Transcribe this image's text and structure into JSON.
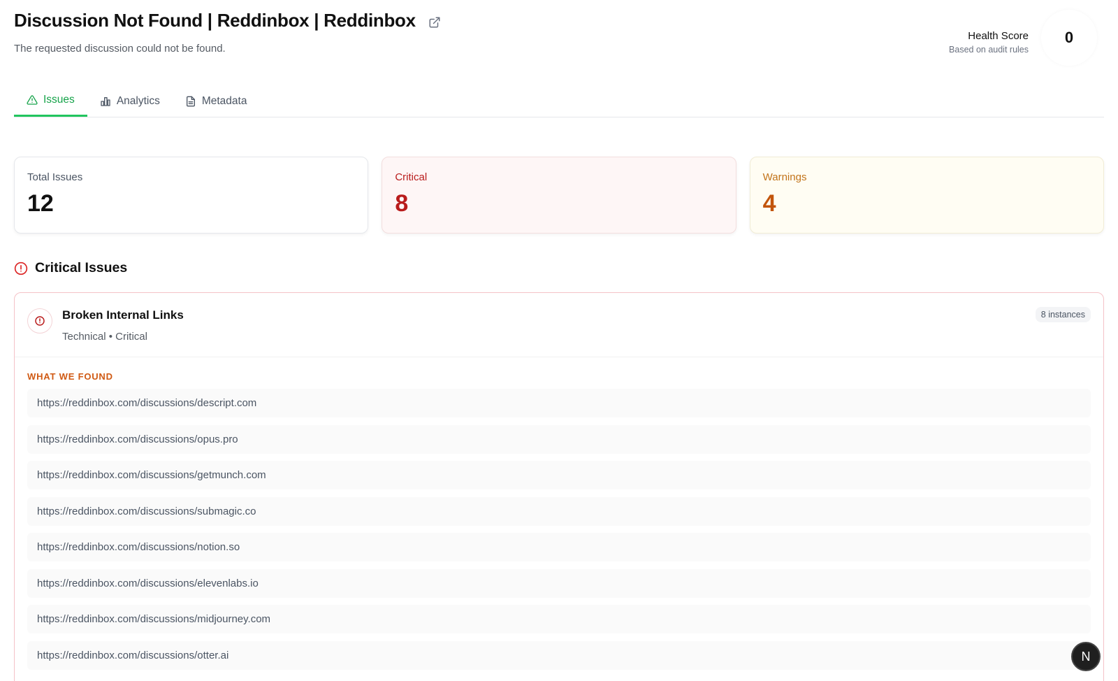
{
  "header": {
    "title": "Discussion Not Found | Reddinbox | Reddinbox",
    "subtitle": "The requested discussion could not be found.",
    "external_icon": "external-link-icon"
  },
  "health": {
    "title": "Health Score",
    "subtitle": "Based on audit rules",
    "score": "0"
  },
  "tabs": [
    {
      "label": "Issues",
      "icon": "alert-triangle-icon",
      "active": true
    },
    {
      "label": "Analytics",
      "icon": "bar-chart-icon",
      "active": false
    },
    {
      "label": "Metadata",
      "icon": "document-icon",
      "active": false
    }
  ],
  "stats": {
    "total": {
      "label": "Total Issues",
      "value": "12"
    },
    "critical": {
      "label": "Critical",
      "value": "8"
    },
    "warnings": {
      "label": "Warnings",
      "value": "4"
    }
  },
  "critical_section": {
    "title": "Critical Issues",
    "issue": {
      "name": "Broken Internal Links",
      "meta": "Technical • Critical",
      "instances": "8 instances",
      "found_label": "WHAT WE FOUND",
      "urls": [
        "https://reddinbox.com/discussions/descript.com",
        "https://reddinbox.com/discussions/opus.pro",
        "https://reddinbox.com/discussions/getmunch.com",
        "https://reddinbox.com/discussions/submagic.co",
        "https://reddinbox.com/discussions/notion.so",
        "https://reddinbox.com/discussions/elevenlabs.io",
        "https://reddinbox.com/discussions/midjourney.com",
        "https://reddinbox.com/discussions/otter.ai"
      ]
    }
  },
  "fab": {
    "label": "N"
  },
  "colors": {
    "accent_green": "#22c55e",
    "critical_red": "#b91c1c",
    "warning_orange": "#c2550c"
  }
}
